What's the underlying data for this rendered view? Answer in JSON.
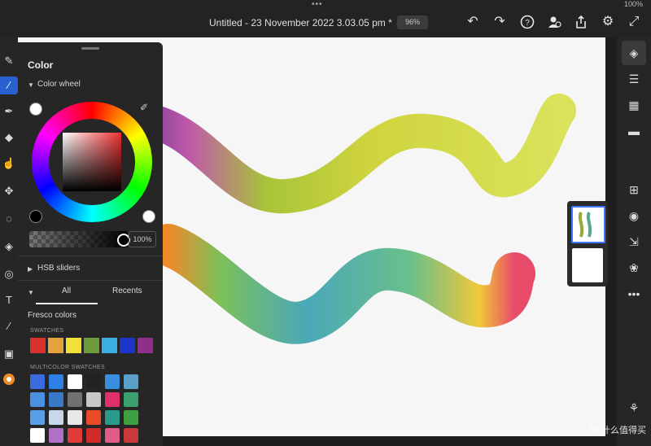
{
  "topbar": {
    "status": "100%",
    "more": "•••",
    "title": "Untitled - 23 November 2022 3.03.05 pm *",
    "title_chevron": "⌄",
    "zoom": "96%",
    "icons": [
      "undo-icon",
      "redo-icon",
      "help-icon",
      "share-user-icon",
      "export-icon",
      "settings-icon",
      "fullscreen-icon"
    ]
  },
  "color_panel": {
    "title": "Color",
    "section": "Color wheel",
    "opacity": "100%",
    "hsb": "HSB sliders",
    "tab_all": "All",
    "tab_recents": "Recents",
    "library": "Fresco colors",
    "swatches_heading": "SWATCHES",
    "multicolor_heading": "MULTICOLOR SWATCHES",
    "swatches": [
      "#d8322c",
      "#e3a23a",
      "#f2df3a",
      "#6c9c3c",
      "#3bb0e0",
      "#1c34c8",
      "#8d2f8b"
    ],
    "multicolor": [
      [
        "#3c6be0",
        "#2f7fe8",
        "#ffffff",
        "#222222",
        "#3a8ee0",
        "#5aa0c8"
      ],
      [
        "#4a8fe0",
        "#3a78c8",
        "#707070",
        "#c8c8c8",
        "#e0306a",
        "#3aa070"
      ],
      [
        "#5a9ee8",
        "#c8d8e8",
        "#e8e8e8",
        "#e84a2a",
        "#2a9a8a",
        "#40a040"
      ],
      [
        "#ffffff",
        "#b070c8",
        "#e03a3a",
        "#d02a2a",
        "#e05a8a",
        "#c83a3a"
      ]
    ]
  },
  "layers": {
    "count": 2
  },
  "watermark": "值 什么值得买"
}
